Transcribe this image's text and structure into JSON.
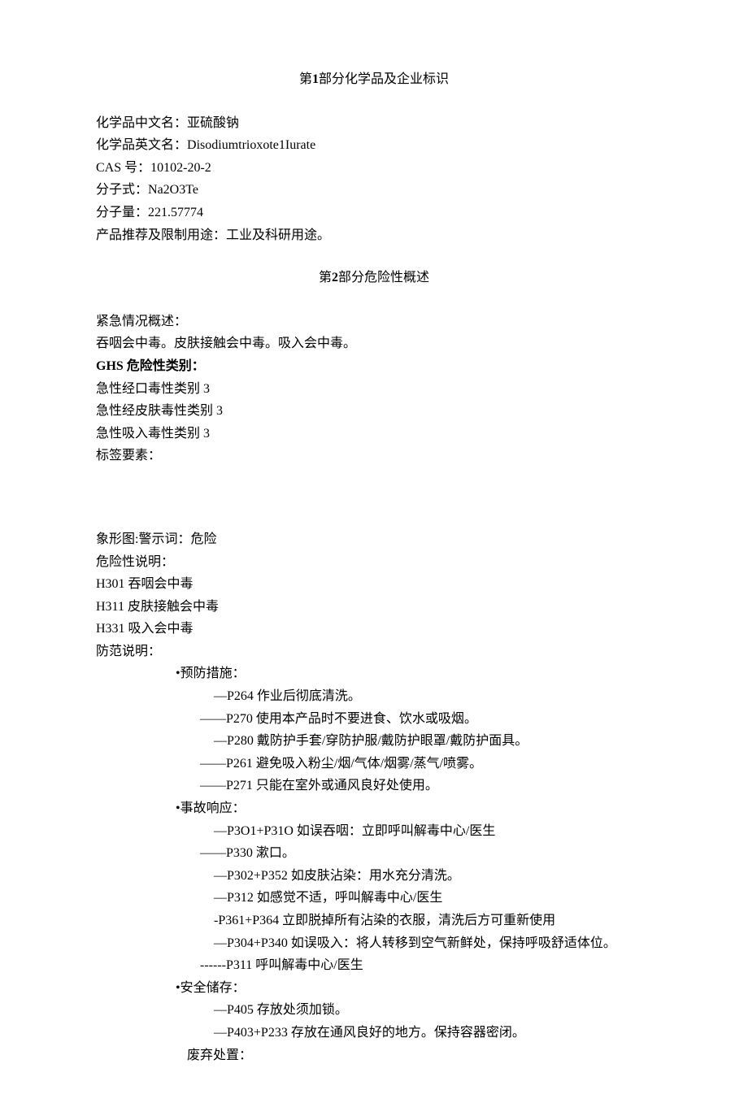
{
  "section1": {
    "title_prefix": "第",
    "title_num": "1",
    "title_suffix": "部分化学品及企业标识",
    "name_cn_label": "化学品中文名：",
    "name_cn": "亚硫酸钠",
    "name_en_label": "化学品英文名：",
    "name_en": "Disodiumtrioxote1Iurate",
    "cas_label": "CAS 号：",
    "cas": "10102-20-2",
    "formula_label": "分子式：",
    "formula": "Na2O3Te",
    "mw_label": "分子量：",
    "mw": "221.57774",
    "use_label": "产品推荐及限制用途：",
    "use": "工业及科研用途。"
  },
  "section2": {
    "title_prefix": "第",
    "title_num": "2",
    "title_suffix": "部分危险性概述",
    "emergency_label": "紧急情况概述：",
    "emergency_text": "吞咽会中毒。皮肤接触会中毒。吸入会中毒。",
    "ghs_label": "GHS 危险性类别：",
    "ghs1": "急性经口毒性类别 3",
    "ghs2": "急性经皮肤毒性类别 3",
    "ghs3": "急性吸入毒性类别 3",
    "label_elements": "标签要素：",
    "pictogram_line": "象形图:警示词：危险",
    "hazard_label": "危险性说明：",
    "h301": "H301 吞咽会中毒",
    "h311": "H311 皮肤接触会中毒",
    "h331": "H331 吸入会中毒",
    "precaution_label": "防范说明：",
    "prevention_header": "•预防措施：",
    "p264": "—P264 作业后彻底清洗。",
    "p270": "——P270 使用本产品时不要进食、饮水或吸烟。",
    "p280": "—P280 戴防护手套/穿防护服/戴防护眼罩/戴防护面具。",
    "p261": "——P261 避免吸入粉尘/烟/气体/烟雾/蒸气/喷雾。",
    "p271": "——P271 只能在室外或通风良好处使用。",
    "response_header": "•事故响应：",
    "p301": "—P3O1+P31O 如误吞咽：立即呼叫解毒中心/医生",
    "p330": "——P330 漱口。",
    "p302": "—P302+P352 如皮肤沾染：用水充分清洗。",
    "p312": "—P312 如感觉不适，呼叫解毒中心/医生",
    "p361": "-P361+P364 立即脱掉所有沾染的衣服，清洗后方可重新使用",
    "p304": "—P304+P340 如误吸入：将人转移到空气新鲜处，保持呼吸舒适体位。",
    "p311": "------P311 呼叫解毒中心/医生",
    "storage_header": "•安全储存：",
    "p405": "—P405 存放处须加锁。",
    "p403": "—P403+P233 存放在通风良好的地方。保持容器密闭。",
    "disposal_header": "废弃处置："
  }
}
